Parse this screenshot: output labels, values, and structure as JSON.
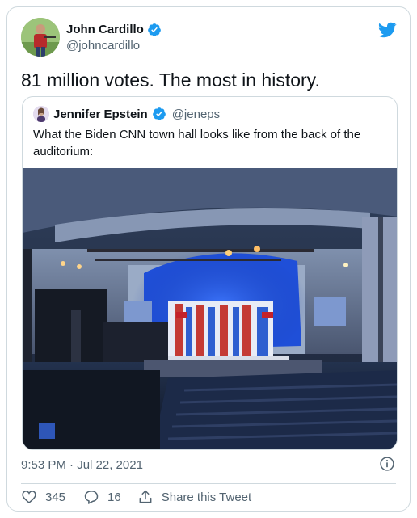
{
  "tweet": {
    "author": {
      "display_name": "John Cardillo",
      "handle": "@johncardillo",
      "verified": true
    },
    "text": "81 million votes. The most in history.",
    "timestamp": "9:53 PM · Jul 22, 2021",
    "actions": {
      "like_count": "345",
      "reply_count": "16",
      "share_label": "Share this Tweet"
    }
  },
  "quoted_tweet": {
    "author": {
      "display_name": "Jennifer Epstein",
      "handle": "@jeneps",
      "verified": true
    },
    "text": "What the Biden CNN town hall looks like from the back of the auditorium:",
    "media_icon": "photo-of-auditorium"
  },
  "colors": {
    "twitter_blue": "#1d9bf0",
    "text_primary": "#0f1419",
    "text_secondary": "#536471",
    "border": "#cfd9de"
  },
  "icons": {
    "brand": "twitter-bird-icon",
    "verified": "verified-badge-icon",
    "info": "info-icon",
    "like": "heart-icon",
    "reply": "reply-bubble-icon",
    "share": "share-upload-icon"
  }
}
